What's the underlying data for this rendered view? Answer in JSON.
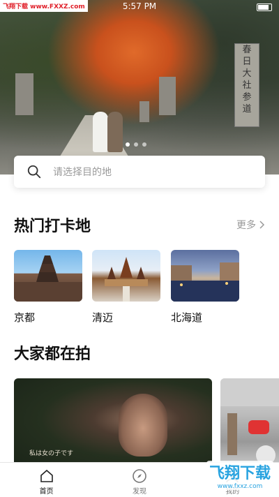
{
  "status": {
    "time": "5:57 PM"
  },
  "watermark_top": "飞翔下载 www.FXXZ.com",
  "hero": {
    "sign_text": [
      "春",
      "日",
      "大",
      "社",
      "参",
      "道"
    ]
  },
  "search": {
    "placeholder": "请选择目的地"
  },
  "hot": {
    "title": "热门打卡地",
    "more_label": "更多",
    "spots": [
      {
        "name": "京都"
      },
      {
        "name": "清迈"
      },
      {
        "name": "北海道"
      }
    ]
  },
  "feed": {
    "title": "大家都在拍",
    "photo_caption": "私は女の子です"
  },
  "tabs": [
    {
      "label": "首页",
      "icon": "home-icon",
      "active": true
    },
    {
      "label": "发现",
      "icon": "compass-icon",
      "active": false
    },
    {
      "label": "我的",
      "icon": "user-icon",
      "active": false
    }
  ],
  "watermark_bottom": {
    "brand": "飞翔下载",
    "url": "www.fxxz.com"
  }
}
